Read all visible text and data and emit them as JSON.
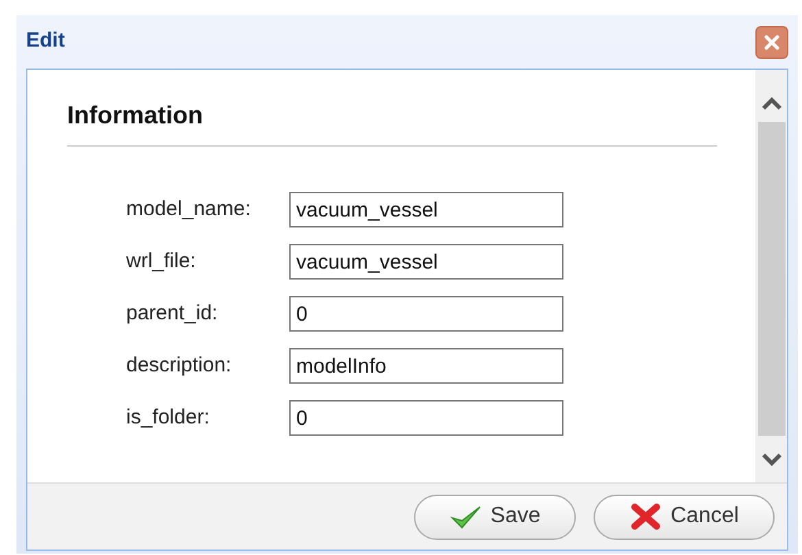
{
  "window": {
    "title": "Edit"
  },
  "section": {
    "title": "Information"
  },
  "fields": [
    {
      "label": "model_name:",
      "value": "vacuum_vessel"
    },
    {
      "label": "wrl_file:",
      "value": "vacuum_vessel"
    },
    {
      "label": "parent_id:",
      "value": "0"
    },
    {
      "label": "description:",
      "value": "modelInfo"
    },
    {
      "label": "is_folder:",
      "value": "0"
    }
  ],
  "buttons": [
    {
      "kind": "save",
      "label": "Save"
    },
    {
      "kind": "cancel",
      "label": "Cancel"
    }
  ]
}
